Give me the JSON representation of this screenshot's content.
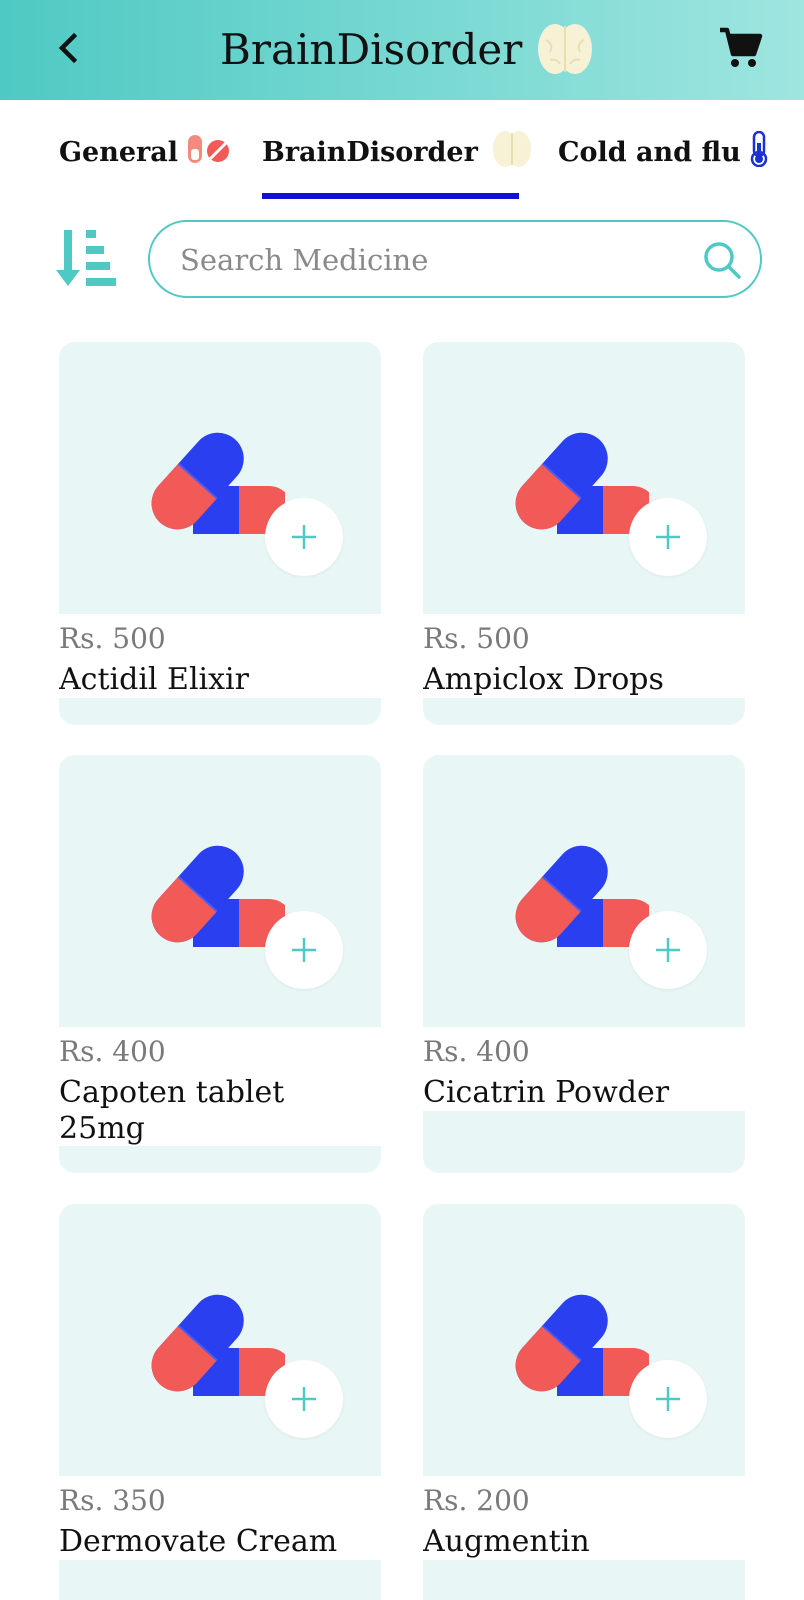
{
  "header": {
    "title": "BrainDisorder",
    "back_icon": "back-arrow-icon",
    "brain_icon": "brain-icon",
    "cart_icon": "cart-icon"
  },
  "tabs": [
    {
      "label": "General",
      "icon": "pills-icon"
    },
    {
      "label": "BrainDisorder",
      "icon": "brain-icon",
      "active": true
    },
    {
      "label": "Cold and flu",
      "icon": "thermometer-icon"
    }
  ],
  "search": {
    "placeholder": "Search Medicine",
    "value": ""
  },
  "colors": {
    "accent": "#4fc9c3",
    "active_tab": "#1111d6",
    "card_bg": "#e8f6f6",
    "pill_red": "#f25a57",
    "pill_blue": "#2a3ff0"
  },
  "products": [
    {
      "price": "Rs. 500",
      "name": "Actidil Elixir"
    },
    {
      "price": "Rs. 500",
      "name": "Ampiclox Drops"
    },
    {
      "price": "Rs. 400",
      "name": "Capoten tablet 25mg"
    },
    {
      "price": "Rs. 400",
      "name": "Cicatrin Powder"
    },
    {
      "price": "Rs. 350",
      "name": "Dermovate Cream"
    },
    {
      "price": "Rs. 200",
      "name": "Augmentin"
    }
  ]
}
